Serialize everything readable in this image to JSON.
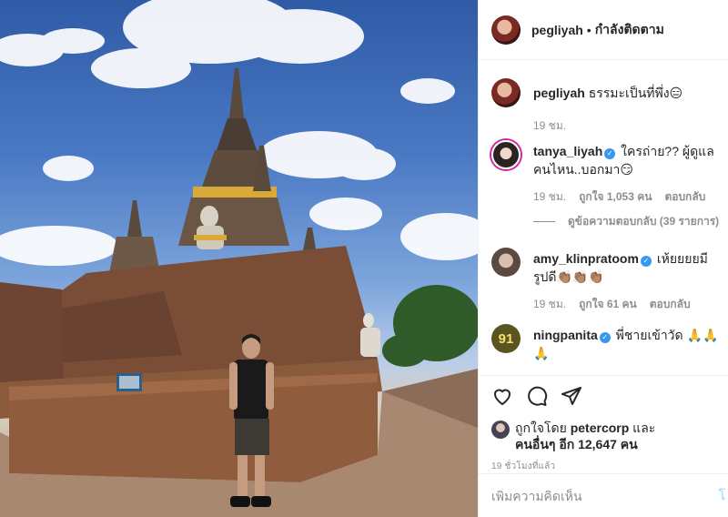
{
  "header": {
    "username": "pegliyah",
    "separator": "•",
    "follow_status": "กำลังติดตาม"
  },
  "caption": {
    "username": "pegliyah",
    "text": "ธรรมะเป็นที่พึ่ง😑",
    "time": "19 ชม."
  },
  "comments": [
    {
      "username": "tanya_liyah",
      "verified": true,
      "text": "ใครถ่าย?? ผู้ดูแลคนไหน..บอกมา😏",
      "time": "19 ชม.",
      "likes": "ถูกใจ 1,053 คน",
      "reply": "ตอบกลับ",
      "view_replies": "ดูข้อความตอบกลับ (39 รายการ)"
    },
    {
      "username": "amy_klinpratoom",
      "verified": true,
      "text": "เห้ยยยยมีรูปดี👏🏽👏🏽👏🏽",
      "time": "19 ชม.",
      "likes": "ถูกใจ 61 คน",
      "reply": "ตอบกลับ"
    },
    {
      "username": "ningpanita",
      "verified": true,
      "avatar_text": "91",
      "text": "พี่ชายเข้าวัด 🙏🙏🙏"
    }
  ],
  "likes_summary": {
    "prefix": "ถูกใจโดย ",
    "user": "petercorp",
    "middle": " และ",
    "others": "คนอื่นๆ อีก 12,647 คน"
  },
  "timestamp": "19 ชั่วโมงที่แล้ว",
  "add_comment": {
    "placeholder": "เพิ่มความคิดเห็น",
    "post_label": "โ"
  },
  "icons": [
    "heart-icon",
    "comment-icon",
    "share-icon",
    "verified-icon"
  ],
  "colors": {
    "verified": "#3897f0",
    "muted": "#8e8e8e",
    "post_button": "#b2dffc"
  }
}
